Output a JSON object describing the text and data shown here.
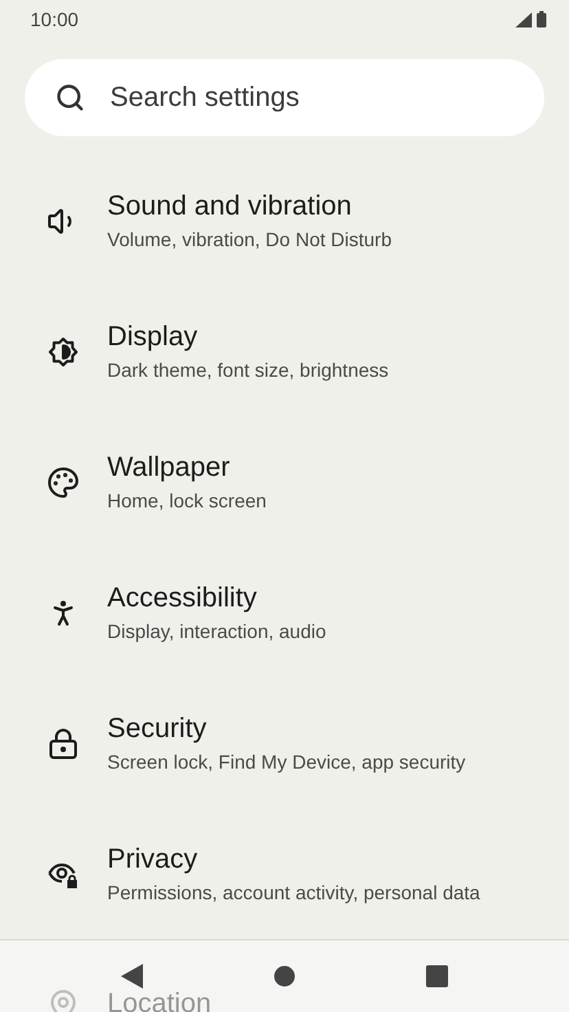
{
  "status_bar": {
    "time": "10:00"
  },
  "search": {
    "placeholder": "Search settings"
  },
  "items": [
    {
      "title": "Sound and vibration",
      "subtitle": "Volume, vibration, Do Not Disturb"
    },
    {
      "title": "Display",
      "subtitle": "Dark theme, font size, brightness"
    },
    {
      "title": "Wallpaper",
      "subtitle": "Home, lock screen"
    },
    {
      "title": "Accessibility",
      "subtitle": "Display, interaction, audio"
    },
    {
      "title": "Security",
      "subtitle": "Screen lock, Find My Device, app security"
    },
    {
      "title": "Privacy",
      "subtitle": "Permissions, account activity, personal data"
    },
    {
      "title": "Location"
    }
  ]
}
